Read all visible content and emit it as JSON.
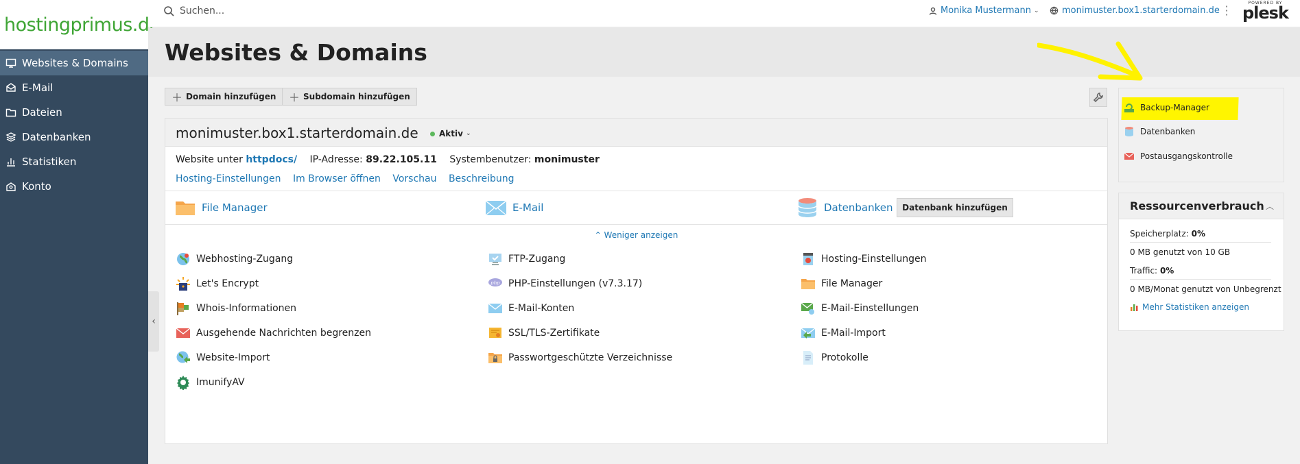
{
  "sidebar": {
    "logo": "hostingprimus.de",
    "items": [
      {
        "label": "Websites & Domains",
        "icon": "monitor-icon",
        "active": true
      },
      {
        "label": "E-Mail",
        "icon": "mail-icon"
      },
      {
        "label": "Dateien",
        "icon": "folder-icon"
      },
      {
        "label": "Datenbanken",
        "icon": "database-icon"
      },
      {
        "label": "Statistiken",
        "icon": "chart-icon"
      },
      {
        "label": "Konto",
        "icon": "account-icon"
      }
    ],
    "collapse_icon": "‹"
  },
  "topbar": {
    "search_placeholder": "Suchen...",
    "user": "Monika Mustermann",
    "domain": "monimuster.box1.starterdomain.de",
    "powered_by": "POWERED BY",
    "brand": "plesk"
  },
  "page": {
    "title": "Websites & Domains"
  },
  "toolbar": {
    "add_domain": "Domain hinzufügen",
    "add_subdomain": "Subdomain hinzufügen"
  },
  "domain": {
    "name": "monimuster.box1.starterdomain.de",
    "status": "Aktiv",
    "website_label": "Website unter",
    "website_path": "httpdocs/",
    "ip_label": "IP-Adresse:",
    "ip": "89.22.105.11",
    "sysuser_label": "Systembenutzer:",
    "sysuser": "monimuster",
    "links": [
      "Hosting-Einstellungen",
      "Im Browser öffnen",
      "Vorschau",
      "Beschreibung"
    ],
    "apps": {
      "file_manager": "File Manager",
      "email": "E-Mail",
      "databases": "Datenbanken",
      "add_db": "Datenbank hinzufügen"
    },
    "show_less": "Weniger anzeigen",
    "tools": [
      [
        "Webhosting-Zugang",
        "FTP-Zugang",
        "Hosting-Einstellungen"
      ],
      [
        "Let's Encrypt",
        "PHP-Einstellungen (v7.3.17)",
        "File Manager"
      ],
      [
        "Whois-Informationen",
        "E-Mail-Konten",
        "E-Mail-Einstellungen"
      ],
      [
        "Ausgehende Nachrichten begrenzen",
        "SSL/TLS-Zertifikate",
        "E-Mail-Import"
      ],
      [
        "Website-Import",
        "Passwortgeschützte Verzeichnisse",
        "Protokolle"
      ],
      [
        "ImunifyAV"
      ]
    ]
  },
  "rightpanel": {
    "items": [
      "Backup-Manager",
      "Datenbanken",
      "Postausgangskontrolle"
    ],
    "resources": {
      "title": "Ressourcenverbrauch",
      "disk_label": "Speicherplatz:",
      "disk_pct": "0%",
      "disk_detail": "0 MB genutzt von 10 GB",
      "traffic_label": "Traffic:",
      "traffic_pct": "0%",
      "traffic_detail": "0 MB/Monat genutzt von Unbegrenzt",
      "more_stats": "Mehr Statistiken anzeigen"
    }
  },
  "colors": {
    "sidebar": "#34495e",
    "link": "#1f78b4",
    "highlight": "#fff500",
    "brand": "#3fa535"
  }
}
